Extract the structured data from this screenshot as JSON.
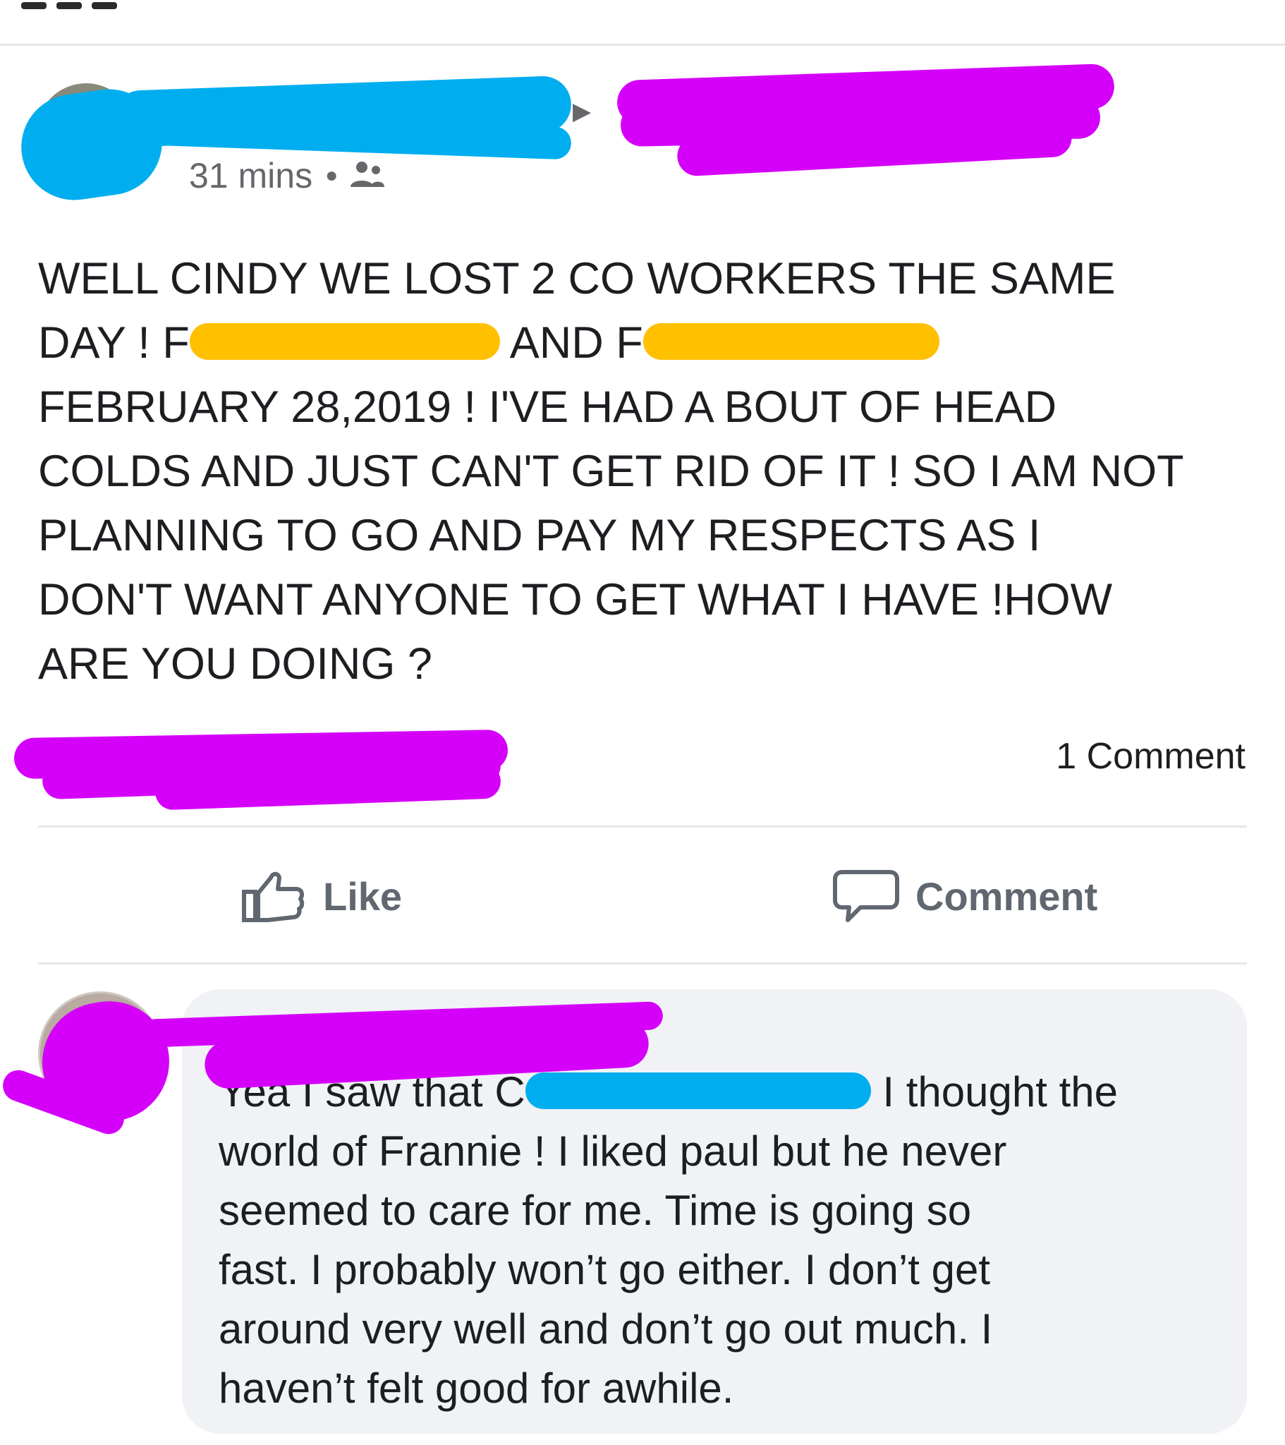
{
  "colors": {
    "redaction_blue": "#00aeef",
    "redaction_magenta": "#d500f9",
    "redaction_yellow": "#ffc000",
    "reaction_blue": "#1877f2",
    "divider": "#e4e6eb",
    "bubble": "#f0f2f5",
    "meta_text": "#65676b"
  },
  "post": {
    "time": "31 mins",
    "privacy_icon": "friends-icon",
    "share_arrow_icon": "triangle-right-icon",
    "body_lines": [
      "WELL CINDY WE LOST 2 CO WORKERS THE SAME",
      [
        "DAY !  F",
        " AND F",
        " "
      ],
      "FEBRUARY 28,2019 !   I'VE HAD A BOUT OF HEAD",
      "COLDS AND JUST CAN'T GET RID OF IT ! SO I AM NOT",
      "PLANNING TO GO AND PAY MY RESPECTS AS I",
      "DON'T WANT ANYONE TO GET WHAT I HAVE !HOW",
      "ARE YOU DOING ?"
    ],
    "comment_count": "1 Comment"
  },
  "actions": {
    "like_label": "Like",
    "like_icon": "thumbs-up-icon",
    "comment_label": "Comment",
    "comment_icon": "speech-bubble-icon"
  },
  "comment": {
    "text_lines": [
      [
        "Yea I saw that C",
        "I thought the"
      ],
      "world of Frannie ! I liked paul but he never",
      "seemed to care for me. Time is going so",
      "fast. I probably won’t go either. I don’t get",
      "around very well and don’t go out much. I",
      "haven’t felt good for awhile."
    ]
  }
}
